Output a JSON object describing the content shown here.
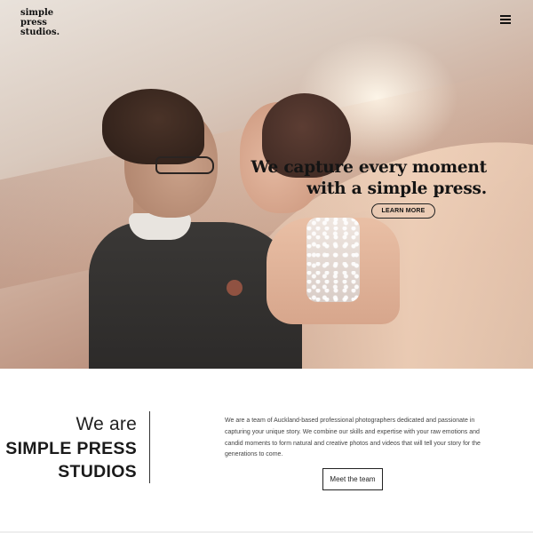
{
  "header": {
    "logo_lines": [
      "simple",
      "press",
      "studios."
    ],
    "menu_icon": "hamburger-menu-icon"
  },
  "hero": {
    "title_line1": "We capture every moment",
    "title_line2": "with a simple press.",
    "button_label": "LEARN MORE"
  },
  "about": {
    "heading_small": "We are",
    "heading_line1": "SIMPLE PRESS",
    "heading_line2": "STUDIOS",
    "description": "We are a team of Auckland-based professional photographers dedicated and passionate in capturing your unique story. We combine our skills and expertise with your raw emotions and candid moments to form natural and creative photos and videos that will tell your story for the generations to come.",
    "button_label": "Meet the team"
  },
  "colors": {
    "text_dark": "#141414",
    "background": "#ffffff"
  }
}
